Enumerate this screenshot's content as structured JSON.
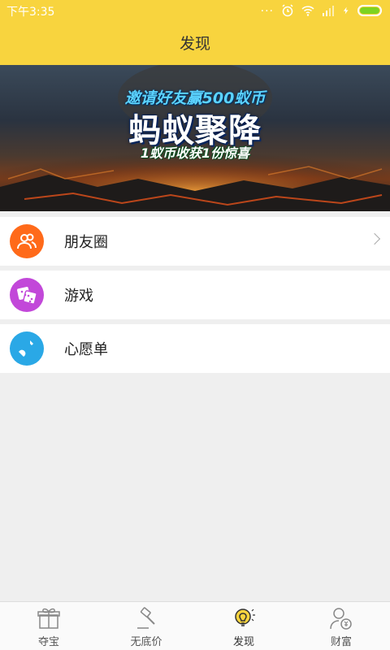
{
  "statusbar": {
    "time": "下午3:35",
    "dots": "..."
  },
  "header": {
    "title": "发现"
  },
  "banner": {
    "line1": "邀请好友赢500蚁币",
    "line2": "蚂蚁聚降",
    "line3": "1蚁币收获1份惊喜"
  },
  "list": {
    "items": [
      {
        "label": "朋友圈",
        "icon": "friends-icon",
        "color": "#ff6a1a"
      },
      {
        "label": "游戏",
        "icon": "dice-icon",
        "color": "#c248d9"
      },
      {
        "label": "心愿单",
        "icon": "wish-bottle-icon",
        "color": "#2aa8e6"
      }
    ]
  },
  "tabbar": {
    "tabs": [
      {
        "label": "夺宝",
        "icon": "gift-icon"
      },
      {
        "label": "无底价",
        "icon": "gavel-icon"
      },
      {
        "label": "发现",
        "icon": "lightbulb-icon",
        "active": true
      },
      {
        "label": "财富",
        "icon": "user-money-icon"
      }
    ]
  }
}
